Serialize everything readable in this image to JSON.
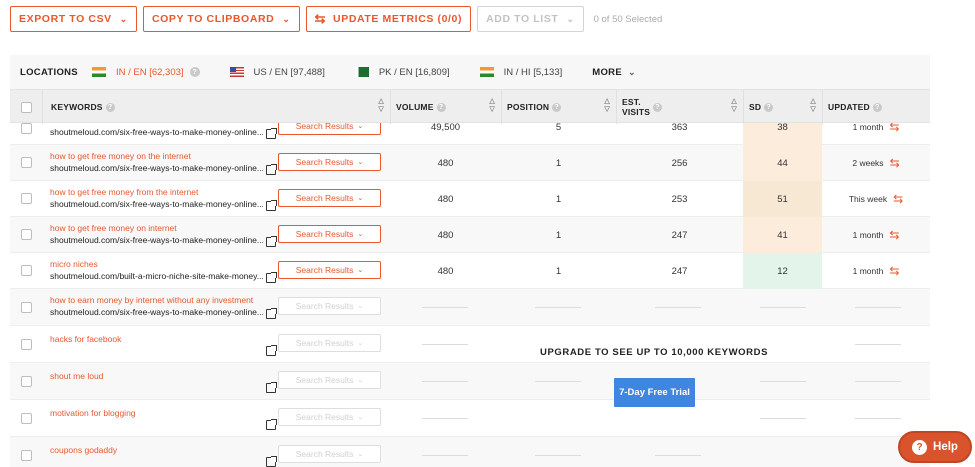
{
  "toolbar": {
    "export_csv": "EXPORT TO CSV",
    "copy_clipboard": "COPY TO CLIPBOARD",
    "update_metrics": "UPDATE METRICS (0/0)",
    "add_to_list": "ADD TO LIST",
    "selected_count": "0 of 50 Selected"
  },
  "locations": {
    "label": "LOCATIONS",
    "items": [
      {
        "code": "IN / EN",
        "count": "[62,303]",
        "flag": "india-flag-icon",
        "active": true
      },
      {
        "code": "US / EN",
        "count": "[97,488]",
        "flag": "us-flag-icon",
        "active": false
      },
      {
        "code": "PK / EN",
        "count": "[16,809]",
        "flag": "pakistan-flag-icon",
        "active": false
      },
      {
        "code": "IN / HI",
        "count": "[5,133]",
        "flag": "india-flag-icon",
        "active": false
      }
    ],
    "more": "MORE"
  },
  "table": {
    "headers": {
      "keywords": "KEYWORDS",
      "volume": "VOLUME",
      "position": "POSITION",
      "est_visits": "EST. VISITS",
      "sd": "SD",
      "updated": "UPDATED"
    },
    "rows": [
      {
        "keyword": "",
        "url": "shoutmeloud.com/six-free-ways-to-make-money-online...",
        "search_results": "Search Results",
        "volume": "49,500",
        "position": "5",
        "visits": "363",
        "sd": "38",
        "sd_color": "#fbecdc",
        "updated": "1 month"
      },
      {
        "keyword": "how to get free money on the internet",
        "url": "shoutmeloud.com/six-free-ways-to-make-money-online...",
        "search_results": "Search Results",
        "volume": "480",
        "position": "1",
        "visits": "256",
        "sd": "44",
        "sd_color": "#fbecdc",
        "updated": "2 weeks"
      },
      {
        "keyword": "how to get free money from the internet",
        "url": "shoutmeloud.com/six-free-ways-to-make-money-online...",
        "search_results": "Search Results",
        "volume": "480",
        "position": "1",
        "visits": "253",
        "sd": "51",
        "sd_color": "#f7e8d3",
        "updated": "This week"
      },
      {
        "keyword": "how to get free money on internet",
        "url": "shoutmeloud.com/six-free-ways-to-make-money-online...",
        "search_results": "Search Results",
        "volume": "480",
        "position": "1",
        "visits": "247",
        "sd": "41",
        "sd_color": "#fbecdc",
        "updated": "1 month"
      },
      {
        "keyword": "micro niches",
        "url": "shoutmeloud.com/built-a-micro-niche-site-make-money...",
        "search_results": "Search Results",
        "volume": "480",
        "position": "1",
        "visits": "247",
        "sd": "12",
        "sd_color": "#e3f4ea",
        "updated": "1 month"
      }
    ],
    "locked_rows": [
      {
        "keyword": "how to earn money by internet without any investment",
        "url": "shoutmeloud.com/six-free-ways-to-make-money-online...",
        "search_results": "Search Results"
      },
      {
        "keyword": "hacks for facebook",
        "url": "",
        "search_results": "Search Results"
      },
      {
        "keyword": "shout me loud",
        "url": "",
        "search_results": "Search Results"
      },
      {
        "keyword": "motivation for blogging",
        "url": "",
        "search_results": "Search Results"
      },
      {
        "keyword": "coupons godaddy",
        "url": "",
        "search_results": "Search Results"
      }
    ]
  },
  "upgrade": {
    "message": "UPGRADE TO SEE UP TO 10,000 KEYWORDS",
    "trial_button": "7-Day Free Trial"
  },
  "help": {
    "label": "Help"
  },
  "colors": {
    "accent": "#e8572e",
    "trial": "#3f86e0",
    "help": "#d9532c"
  }
}
